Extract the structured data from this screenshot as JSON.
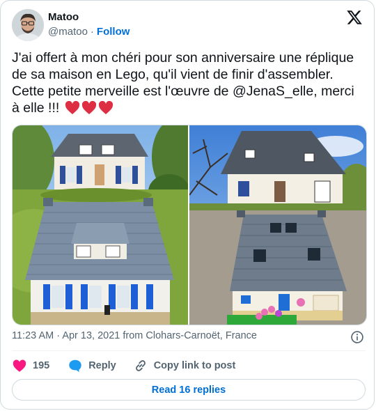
{
  "author": {
    "name": "Matoo",
    "handle": "@matoo",
    "separator": "·",
    "follow_label": "Follow",
    "avatar_icon": "avatar-photo"
  },
  "brand_icon": "x-logo-icon",
  "tweet": {
    "text_before_mention": "J'ai offert à mon chéri pour son anniversaire une réplique de sa maison en Lego, qu'il vient de finir d'assembler. Cette petite merveille est l'œuvre de ",
    "mention": "@JenaS_elle",
    "text_after_mention": ", merci à elle !!! ",
    "emoji": "❤️❤️❤️"
  },
  "media": [
    {
      "icon": "photo-lego-house-left"
    },
    {
      "icon": "photo-lego-house-right"
    }
  ],
  "meta": {
    "time": "11:23 AM",
    "separator": "·",
    "date": "Apr 13, 2021",
    "location_prefix": "from",
    "location": "Clohars-Carnoët, France",
    "info_icon": "info-icon"
  },
  "actions": {
    "like_count": "195",
    "reply_label": "Reply",
    "copy_label": "Copy link to post"
  },
  "read_replies_label": "Read 16 replies",
  "colors": {
    "accent": "#006fd6",
    "like": "#f91880",
    "reply": "#1d9bf0",
    "text": "#0f1419",
    "secondary": "#536471",
    "border": "#cfd9de"
  }
}
